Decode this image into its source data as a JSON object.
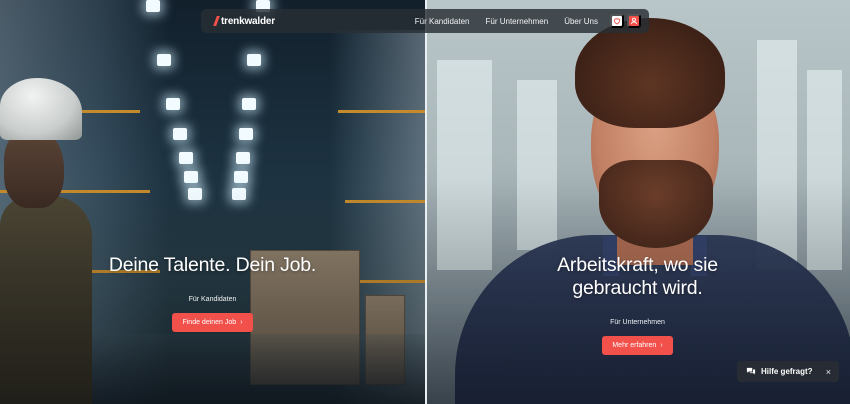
{
  "nav": {
    "logo_text": "trenkwalder",
    "links": [
      "Für Kandidaten",
      "Für Unternehmen",
      "Über Uns"
    ],
    "favorites_icon": "heart-icon",
    "account_icon": "user-icon",
    "accent": "#f2504b"
  },
  "hero": {
    "left": {
      "title": "Deine Talente. Dein Job.",
      "eyebrow": "Für Kandidaten",
      "button_label": "Finde deinen Job"
    },
    "right": {
      "title": "Arbeitskraft, wo sie gebraucht wird.",
      "eyebrow": "Für Unternehmen",
      "button_label": "Mehr erfahren"
    }
  },
  "help": {
    "label": "Hilfe gefragt?",
    "icon": "chat-icon",
    "close_glyph": "×"
  }
}
